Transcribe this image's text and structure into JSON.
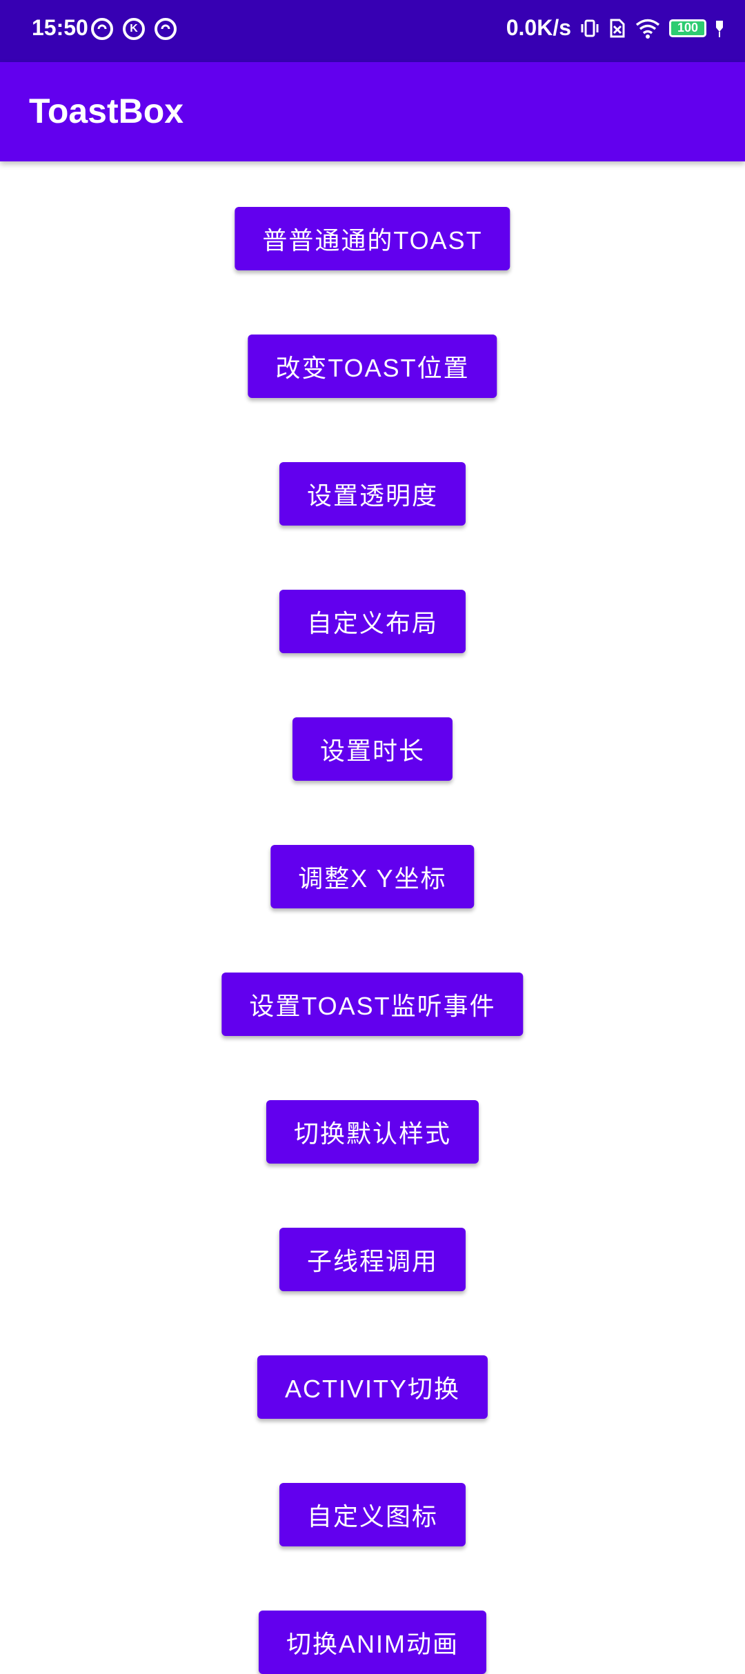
{
  "status_bar": {
    "time": "15:50",
    "left_icons": [
      "sync-icon",
      "k-icon",
      "sync-icon"
    ],
    "k_label": "K",
    "net_speed": "0.0K/s",
    "battery": "100",
    "colors": {
      "background": "#3700B3",
      "battery": "#2ecc71"
    }
  },
  "app_bar": {
    "title": "ToastBox",
    "color": "#6200EE"
  },
  "buttons": [
    "普普通通的TOAST",
    "改变TOAST位置",
    "设置透明度",
    "自定义布局",
    "设置时长",
    "调整X Y坐标",
    "设置TOAST监听事件",
    "切换默认样式",
    "子线程调用",
    "ACTIVITY切换",
    "自定义图标",
    "切换ANIM动画"
  ]
}
